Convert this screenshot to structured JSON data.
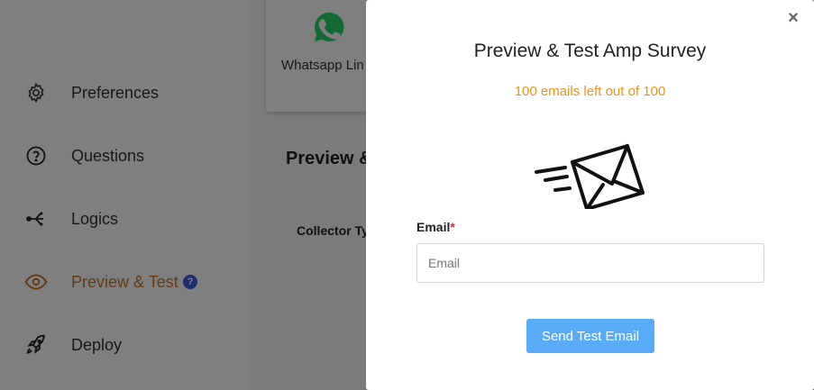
{
  "sidebar": {
    "items": [
      {
        "label": "Preferences",
        "icon": "gear-icon"
      },
      {
        "label": "Questions",
        "icon": "question-circle-icon"
      },
      {
        "label": "Logics",
        "icon": "branch-icon"
      },
      {
        "label": "Preview & Test",
        "icon": "eye-icon",
        "active": true,
        "badge": "?"
      },
      {
        "label": "Deploy",
        "icon": "rocket-icon"
      }
    ]
  },
  "content": {
    "card_label": "Whatsapp Lin",
    "section_title": "Preview &",
    "collector_label": "Collector Typ"
  },
  "modal": {
    "close_label": "×",
    "title": "Preview & Test Amp Survey",
    "quota": "100 emails left out of 100",
    "email_label": "Email",
    "required_mark": "*",
    "email_placeholder": "Email",
    "email_value": "",
    "send_button": "Send Test Email"
  },
  "colors": {
    "accent_orange": "#e8941f",
    "active_nav": "#c8742a",
    "button_blue": "#5aabf5",
    "whatsapp_green": "#25d366",
    "badge_blue": "#3b5bdb"
  }
}
